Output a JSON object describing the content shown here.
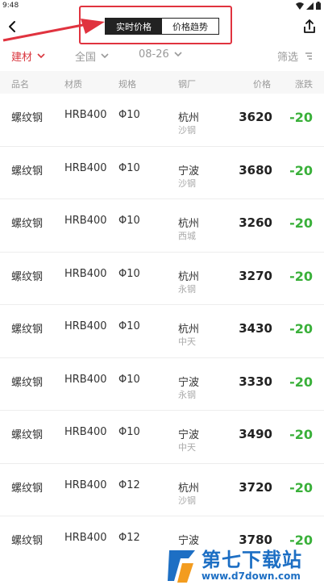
{
  "status_bar": {
    "time": "9:48"
  },
  "header": {
    "tabs": [
      {
        "label": "实时价格",
        "active": true
      },
      {
        "label": "价格趋势",
        "active": false
      }
    ]
  },
  "filters": {
    "category": "建材",
    "region": "全国",
    "date": "08-26",
    "screen": "筛选"
  },
  "columns": [
    "品名",
    "材质",
    "规格",
    "钢厂",
    "价格",
    "涨跌"
  ],
  "rows": [
    {
      "name": "螺纹钢",
      "material": "HRB400",
      "spec": "Φ10",
      "city": "杭州",
      "mill": "沙钢",
      "price": "3620",
      "change": "-20"
    },
    {
      "name": "螺纹钢",
      "material": "HRB400",
      "spec": "Φ10",
      "city": "宁波",
      "mill": "沙钢",
      "price": "3680",
      "change": "-20"
    },
    {
      "name": "螺纹钢",
      "material": "HRB400",
      "spec": "Φ10",
      "city": "杭州",
      "mill": "西城",
      "price": "3260",
      "change": "-20"
    },
    {
      "name": "螺纹钢",
      "material": "HRB400",
      "spec": "Φ10",
      "city": "杭州",
      "mill": "永钢",
      "price": "3270",
      "change": "-20"
    },
    {
      "name": "螺纹钢",
      "material": "HRB400",
      "spec": "Φ10",
      "city": "杭州",
      "mill": "中天",
      "price": "3430",
      "change": "-20"
    },
    {
      "name": "螺纹钢",
      "material": "HRB400",
      "spec": "Φ10",
      "city": "宁波",
      "mill": "永钢",
      "price": "3330",
      "change": "-20"
    },
    {
      "name": "螺纹钢",
      "material": "HRB400",
      "spec": "Φ10",
      "city": "宁波",
      "mill": "中天",
      "price": "3490",
      "change": "-20"
    },
    {
      "name": "螺纹钢",
      "material": "HRB400",
      "spec": "Φ12",
      "city": "杭州",
      "mill": "沙钢",
      "price": "3720",
      "change": "-20"
    },
    {
      "name": "螺纹钢",
      "material": "HRB400",
      "spec": "Φ12",
      "city": "宁波",
      "mill": "",
      "price": "3780",
      "change": "-20"
    }
  ],
  "watermark": {
    "title": "第七下载站",
    "url": "www.d7down.com"
  },
  "colors": {
    "accent": "#d9363e",
    "down": "#3ab03a",
    "annotation": "#e0333f"
  },
  "icons": [
    "back-arrow-icon",
    "share-icon",
    "chevron-down-icon",
    "filter-icon",
    "wifi-icon",
    "signal-icon",
    "battery-icon"
  ]
}
